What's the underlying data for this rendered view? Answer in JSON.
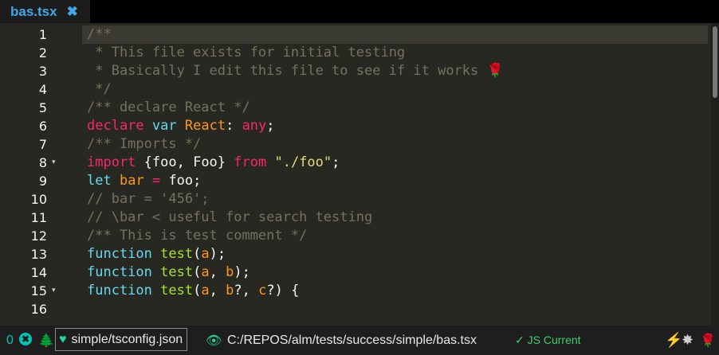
{
  "tab": {
    "filename": "bas.tsx",
    "close_glyph": "✖"
  },
  "gutter": {
    "lines": [
      "1",
      "2",
      "3",
      "4",
      "5",
      "6",
      "7",
      "8",
      "9",
      "10",
      "11",
      "12",
      "13",
      "14",
      "15",
      "16"
    ],
    "fold_glyph": "▾"
  },
  "code": {
    "line1": "/**",
    "line2": " * This file exists for initial testing",
    "line3": " * Basically I edit this file to see if it works 🌹",
    "line4": " */",
    "line5": "/** declare React */",
    "line6": {
      "kw": "declare",
      "st": "var",
      "name": "React",
      "colon": ":",
      "type": "any",
      "end": ";"
    },
    "line7": "/** Imports */",
    "line8": {
      "kw": "import",
      "brace": "{foo, Foo}",
      "from": "from",
      "str": "\"./foo\"",
      "end": ";"
    },
    "line9": {
      "kw": "let",
      "name": "bar",
      "eq": "=",
      "val": "foo;"
    },
    "line10": "// bar = '456';",
    "line11": "// \\bar < useful for search testing",
    "line12": "/** This is test comment */",
    "line13": {
      "kw": "function",
      "fn": "test",
      "args": "(a);"
    },
    "line14": {
      "kw": "function",
      "fn": "test",
      "args": "(a, b);"
    },
    "line15": {
      "kw": "function",
      "fn": "test",
      "args": "(a, b?, c?) {"
    },
    "line16": ""
  },
  "status": {
    "error_count": "0",
    "error_glyph": "✖",
    "tree_glyph": "🌲",
    "project_heart": "♥",
    "project": "simple/tsconfig.json",
    "eye_glyph": "👁",
    "file_path": "C:/REPOS/alm/tests/success/simple/bas.tsx",
    "js_status": "✓ JS Current",
    "bolt_glyph": "⚡",
    "gear_glyph": "✸",
    "rose_glyph": "🌹"
  },
  "colors": {
    "keyword": "#f92672",
    "storage": "#66d9ef",
    "variable": "#fd971f",
    "function": "#a6e22e",
    "string": "#e6db74",
    "comment": "#75715e",
    "accent": "#1ed8a0"
  }
}
